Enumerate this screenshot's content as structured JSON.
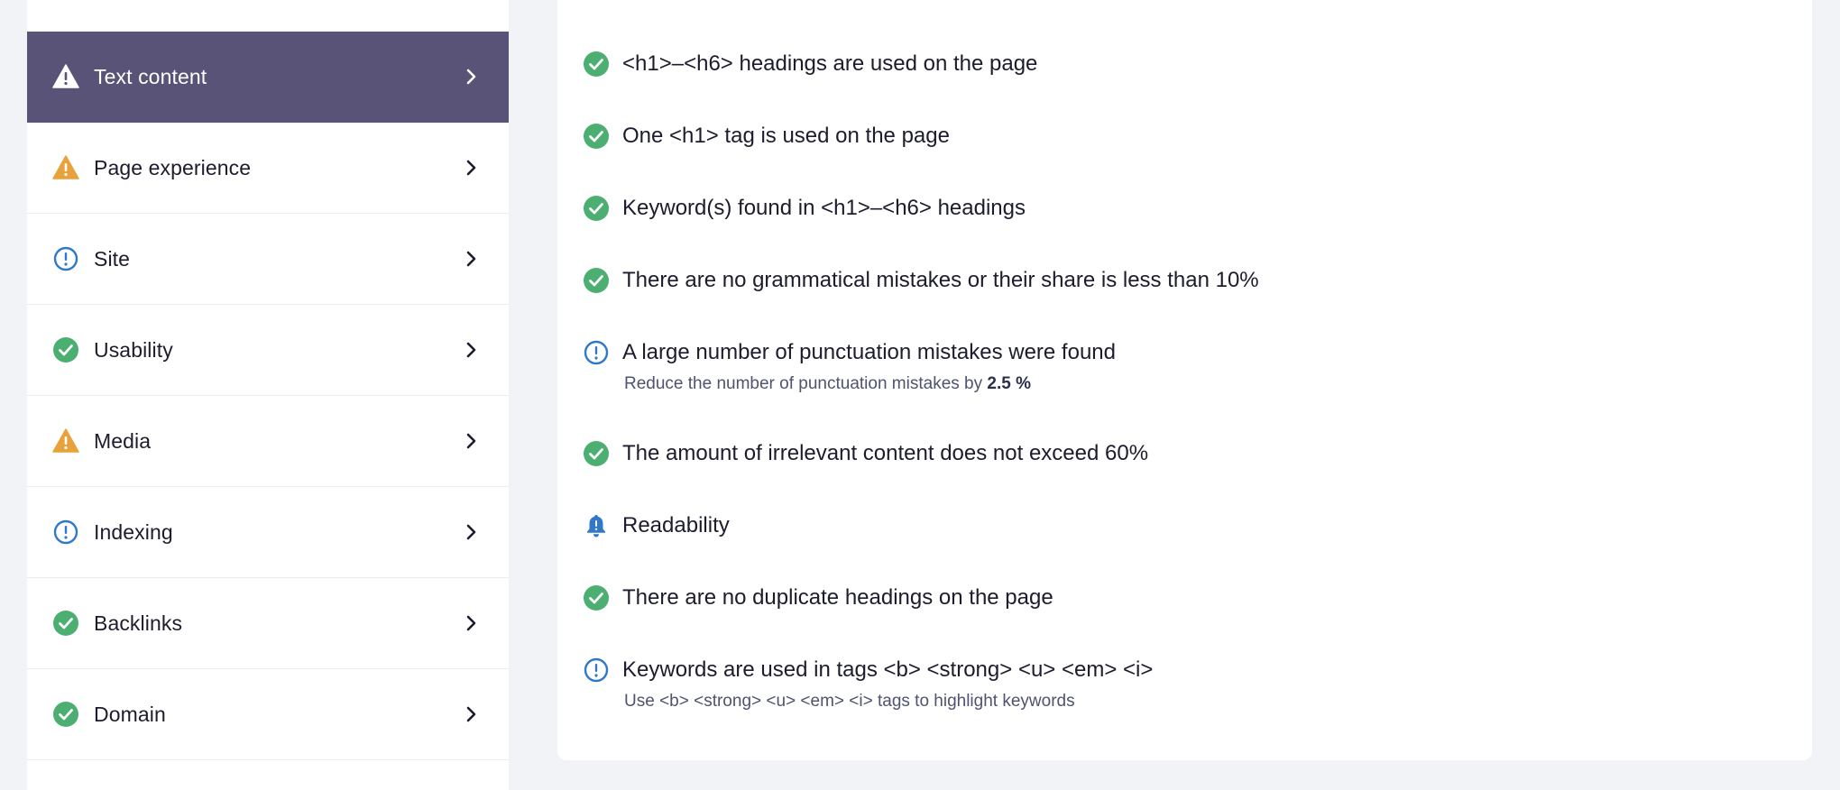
{
  "sidebar": {
    "items": [
      {
        "label": "Text content",
        "icon": "warning-icon",
        "status": "warning",
        "active": true
      },
      {
        "label": "Page experience",
        "icon": "warning-icon",
        "status": "warning",
        "active": false
      },
      {
        "label": "Site",
        "icon": "info-icon",
        "status": "info",
        "active": false
      },
      {
        "label": "Usability",
        "icon": "check-icon",
        "status": "ok",
        "active": false
      },
      {
        "label": "Media",
        "icon": "warning-icon",
        "status": "warning",
        "active": false
      },
      {
        "label": "Indexing",
        "icon": "info-icon",
        "status": "info",
        "active": false
      },
      {
        "label": "Backlinks",
        "icon": "check-icon",
        "status": "ok",
        "active": false
      },
      {
        "label": "Domain",
        "icon": "check-icon",
        "status": "ok",
        "active": false
      }
    ]
  },
  "checks": [
    {
      "title": "<h1>–<h6> headings are used on the page",
      "status": "ok"
    },
    {
      "title": "One <h1> tag is used on the page",
      "status": "ok"
    },
    {
      "title": "Keyword(s) found in <h1>–<h6> headings",
      "status": "ok"
    },
    {
      "title": "There are no grammatical mistakes or their share is less than 10%",
      "status": "ok"
    },
    {
      "title": "A large number of punctuation mistakes were found",
      "status": "info",
      "sub_text": "Reduce the number of punctuation mistakes by ",
      "sub_value": "2.5 %"
    },
    {
      "title": "The amount of irrelevant content does not exceed 60%",
      "status": "ok"
    },
    {
      "title": "Readability",
      "status": "notice"
    },
    {
      "title": "There are no duplicate headings on the page",
      "status": "ok"
    },
    {
      "title": "Keywords are used in tags <b> <strong> <u> <em> <i>",
      "status": "info",
      "sub_text": "Use <b> <strong> <u> <em> <i> tags to highlight keywords"
    }
  ],
  "colors": {
    "active_bg": "#595378",
    "ok": "#4caf72",
    "warning": "#e8a23b",
    "info": "#2f79c8",
    "notice": "#2f79c8"
  }
}
